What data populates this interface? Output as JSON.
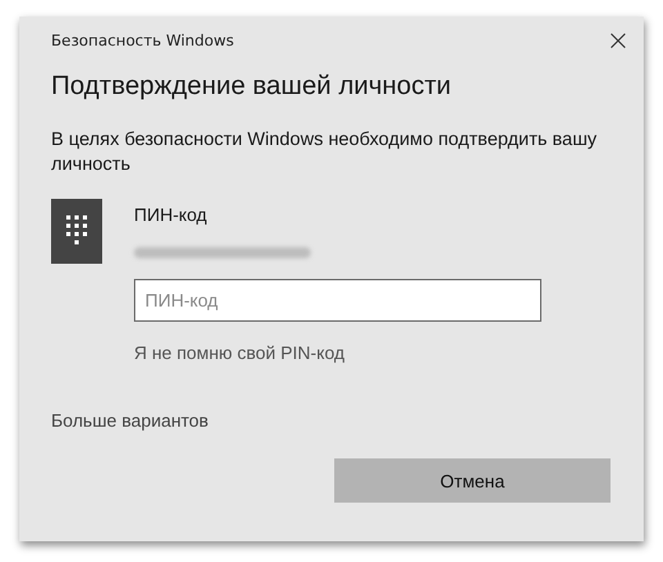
{
  "window": {
    "title": "Безопасность Windows"
  },
  "heading": "Подтверждение вашей личности",
  "description": "В целях безопасности Windows необходимо подтвердить вашу личность",
  "credential": {
    "label": "ПИН-код",
    "pin_field": {
      "placeholder": "ПИН-код"
    },
    "forgot_link": "Я не помню свой PIN-код"
  },
  "more_options": "Больше вариантов",
  "buttons": [
    "Отмена"
  ]
}
